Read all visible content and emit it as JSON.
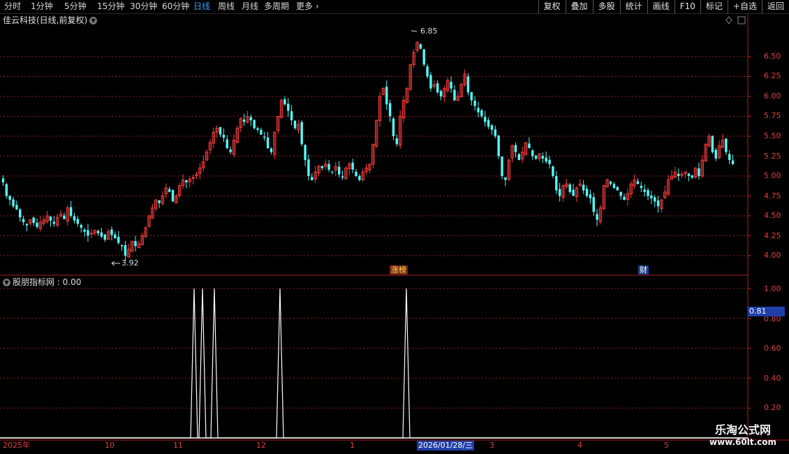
{
  "periods": [
    "分时",
    "1分钟",
    "5分钟",
    "15分钟",
    "30分钟",
    "60分钟",
    "日线",
    "周线",
    "月线",
    "多周期",
    "更多"
  ],
  "active_period_index": 6,
  "tools": [
    "复权",
    "叠加",
    "多股",
    "统计",
    "画线",
    "F10",
    "标记",
    "+自选",
    "返回"
  ],
  "stock_title": "佳云科技(日线,前复权)",
  "indicator_title": "股朋指标网 : 0.00",
  "price_axis": [
    "6.50",
    "6.25",
    "6.00",
    "5.75",
    "5.50",
    "5.25",
    "5.00",
    "4.75",
    "4.50",
    "4.25",
    "4.00"
  ],
  "indicator_axis": [
    "1.00",
    "0.80",
    "0.60",
    "0.40",
    "0.20"
  ],
  "high_label": "6.85",
  "low_label": "3.92",
  "event_labels": {
    "zhangting": "涨榜",
    "cai": "财"
  },
  "date_labels": [
    "2025年",
    "10",
    "11",
    "12",
    "1",
    "3",
    "4",
    "5"
  ],
  "cursor": {
    "date": "2026/01/28/三",
    "value": "0.81"
  },
  "watermark": {
    "line1": "乐淘公式网",
    "line2": "www.60lt.com"
  },
  "colors": {
    "up": "#ff3c3c",
    "down": "#54fcfc",
    "grid": "#8a1e1e",
    "accent": "#3aa0ff"
  },
  "chart_data": {
    "type": "candlestick",
    "closes": [
      4.92,
      4.75,
      4.7,
      4.62,
      4.58,
      4.48,
      4.42,
      4.38,
      4.45,
      4.41,
      4.36,
      4.42,
      4.45,
      4.5,
      4.44,
      4.4,
      4.48,
      4.52,
      4.46,
      4.6,
      4.5,
      4.44,
      4.4,
      4.35,
      4.3,
      4.25,
      4.28,
      4.32,
      4.28,
      4.24,
      4.2,
      4.3,
      4.26,
      4.22,
      4.16,
      4.12,
      4.0,
      4.08,
      4.18,
      4.12,
      4.15,
      4.25,
      4.35,
      4.5,
      4.6,
      4.7,
      4.66,
      4.75,
      4.85,
      4.8,
      4.68,
      4.75,
      4.88,
      4.95,
      4.92,
      4.96,
      4.98,
      5.02,
      5.1,
      5.18,
      5.3,
      5.42,
      5.55,
      5.6,
      5.52,
      5.48,
      5.35,
      5.3,
      5.45,
      5.6,
      5.72,
      5.68,
      5.75,
      5.7,
      5.6,
      5.58,
      5.52,
      5.48,
      5.35,
      5.3,
      5.55,
      5.75,
      5.95,
      5.9,
      5.82,
      5.7,
      5.6,
      5.65,
      5.4,
      5.2,
      5.0,
      4.95,
      5.05,
      5.12,
      5.1,
      5.15,
      5.08,
      5.05,
      5.12,
      5.02,
      4.98,
      5.1,
      5.15,
      5.08,
      5.0,
      4.95,
      5.05,
      5.1,
      5.15,
      5.4,
      5.7,
      6.0,
      6.1,
      5.9,
      5.75,
      5.5,
      5.4,
      5.75,
      5.95,
      6.1,
      6.4,
      6.55,
      6.68,
      6.6,
      6.4,
      6.25,
      6.1,
      6.15,
      6.05,
      6.0,
      6.1,
      6.2,
      6.1,
      5.95,
      6.0,
      6.15,
      6.28,
      6.05,
      5.95,
      5.88,
      5.8,
      5.75,
      5.68,
      5.62,
      5.58,
      5.5,
      5.25,
      5.0,
      4.95,
      5.2,
      5.38,
      5.3,
      5.2,
      5.3,
      5.42,
      5.35,
      5.25,
      5.22,
      5.28,
      5.22,
      5.18,
      5.15,
      5.0,
      4.82,
      4.75,
      4.88,
      4.9,
      4.8,
      4.75,
      4.85,
      4.9,
      4.82,
      4.75,
      4.72,
      4.55,
      4.45,
      4.6,
      4.88,
      4.95,
      4.9,
      4.85,
      4.82,
      4.75,
      4.7,
      4.78,
      4.9,
      4.95,
      4.9,
      4.85,
      4.8,
      4.75,
      4.72,
      4.68,
      4.62,
      4.7,
      4.8,
      4.95,
      5.0,
      5.05,
      5.0,
      5.02,
      5.05,
      5.0,
      4.98,
      5.1,
      5.0,
      5.2,
      5.4,
      5.5,
      5.3,
      5.22,
      5.38,
      5.45,
      5.3,
      5.2,
      5.15
    ],
    "signal_peaks": [
      278,
      290,
      307,
      401,
      582
    ],
    "high": 6.85,
    "low": 3.92,
    "ylim_price": [
      3.9,
      6.9
    ],
    "ylim_indicator": [
      0,
      1
    ]
  }
}
